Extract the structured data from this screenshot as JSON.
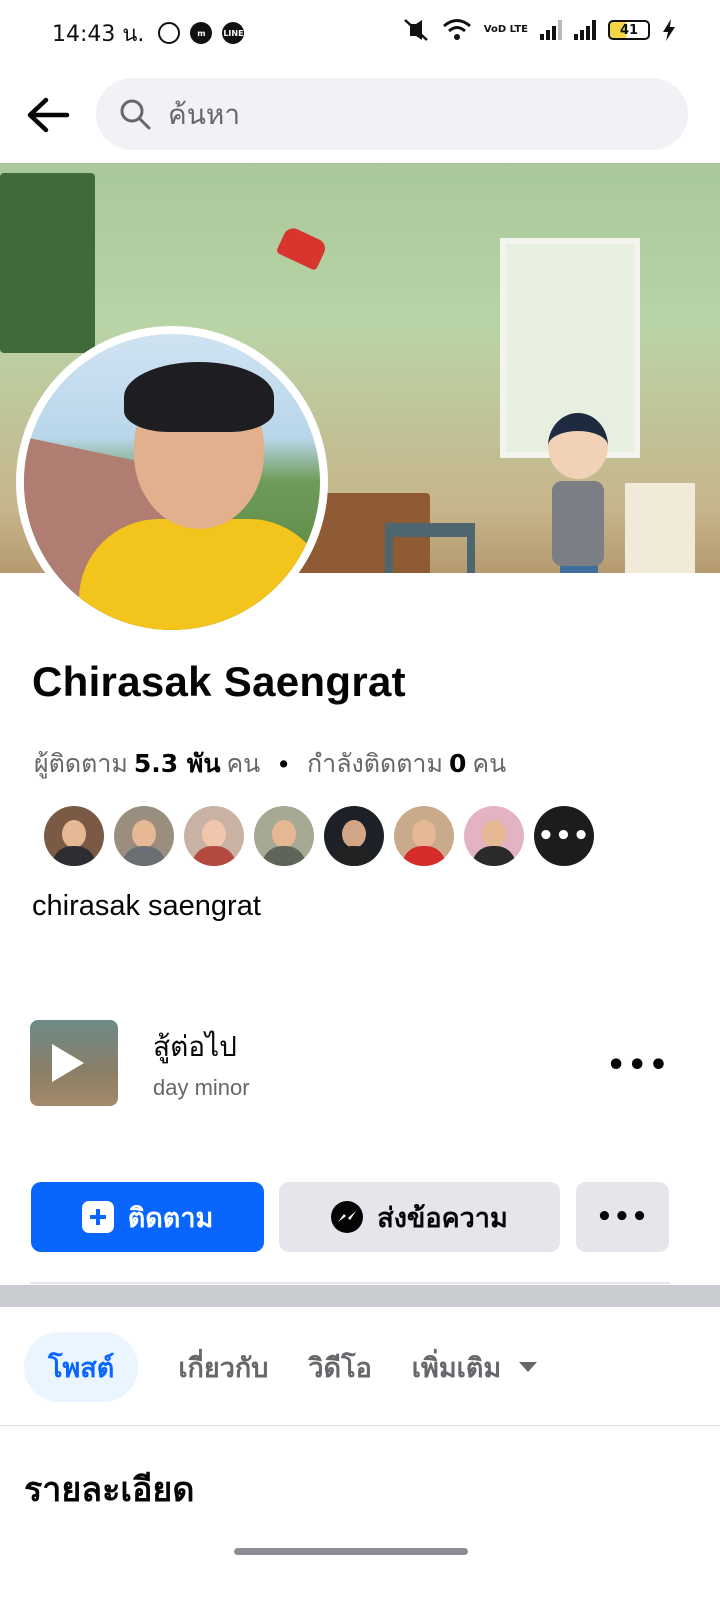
{
  "status_bar": {
    "time": "14:43 น.",
    "battery": "41",
    "network_label": "VoD LTE"
  },
  "search": {
    "placeholder": "ค้นหา"
  },
  "profile": {
    "name": "Chirasak Saengrat",
    "followers_label": "ผู้ติดตาม",
    "followers_count": "5.3 พัน",
    "followers_unit": "คน",
    "separator": "•",
    "following_label": "กำลังติดตาม",
    "following_count": "0",
    "following_unit": "คน",
    "bio": "chirasak saengrat",
    "more_followers_label": "•••"
  },
  "music": {
    "title": "สู้ต่อไป",
    "artist": "day minor",
    "more_label": "•••"
  },
  "actions": {
    "follow_label": "ติดตาม",
    "message_label": "ส่งข้อความ",
    "more_label": "•••"
  },
  "tabs": [
    {
      "label": "โพสต์",
      "active": true
    },
    {
      "label": "เกี่ยวกับ",
      "active": false
    },
    {
      "label": "วิดีโอ",
      "active": false
    },
    {
      "label": "เพิ่มเติม",
      "active": false
    }
  ],
  "section": {
    "title": "รายละเอียด"
  },
  "colors": {
    "primary": "#0866ff",
    "secondary_button": "#e4e6eb",
    "muted_text": "#65676b",
    "active_tab_bg": "#ebf5ff"
  },
  "icons": {
    "back": "arrow-left",
    "search": "magnifier",
    "follow": "plus-badge",
    "message": "messenger",
    "tab_more": "caret-down"
  }
}
